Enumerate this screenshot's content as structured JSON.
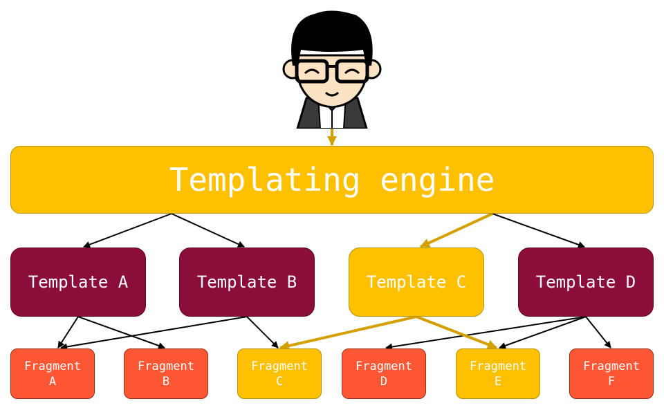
{
  "colors": {
    "highlight": "#FFC000",
    "highlight_edge": "#D4A000",
    "template": "#8B0D3A",
    "fragment": "#FF5733",
    "edge": "#000000"
  },
  "avatar": {
    "icon": "smiling-person-with-glasses"
  },
  "engine": {
    "label": "Templating engine"
  },
  "templates": [
    {
      "id": "tA",
      "label": "Template A",
      "highlighted": false
    },
    {
      "id": "tB",
      "label": "Template B",
      "highlighted": false
    },
    {
      "id": "tC",
      "label": "Template C",
      "highlighted": true
    },
    {
      "id": "tD",
      "label": "Template D",
      "highlighted": false
    }
  ],
  "fragments": [
    {
      "id": "fA",
      "label": "Fragment",
      "letter": "A",
      "highlighted": false
    },
    {
      "id": "fB",
      "label": "Fragment",
      "letter": "B",
      "highlighted": false
    },
    {
      "id": "fC",
      "label": "Fragment",
      "letter": "C",
      "highlighted": true
    },
    {
      "id": "fD",
      "label": "Fragment",
      "letter": "D",
      "highlighted": false
    },
    {
      "id": "fE",
      "label": "Fragment",
      "letter": "E",
      "highlighted": true
    },
    {
      "id": "fF",
      "label": "Fragment",
      "letter": "F",
      "highlighted": false
    }
  ],
  "edges": [
    {
      "from": "avatar",
      "to": "engine",
      "highlighted": true
    },
    {
      "from": "engine",
      "to": "tA",
      "highlighted": false
    },
    {
      "from": "engine",
      "to": "tB",
      "highlighted": false
    },
    {
      "from": "engine",
      "to": "tC",
      "highlighted": true
    },
    {
      "from": "engine",
      "to": "tD",
      "highlighted": false
    },
    {
      "from": "tA",
      "to": "fA",
      "highlighted": false
    },
    {
      "from": "tA",
      "to": "fB",
      "highlighted": false
    },
    {
      "from": "tB",
      "to": "fA",
      "highlighted": false
    },
    {
      "from": "tB",
      "to": "fC",
      "highlighted": false
    },
    {
      "from": "tC",
      "to": "fC",
      "highlighted": true
    },
    {
      "from": "tC",
      "to": "fE",
      "highlighted": true
    },
    {
      "from": "tD",
      "to": "fD",
      "highlighted": false
    },
    {
      "from": "tD",
      "to": "fE",
      "highlighted": false
    },
    {
      "from": "tD",
      "to": "fF",
      "highlighted": false
    }
  ]
}
